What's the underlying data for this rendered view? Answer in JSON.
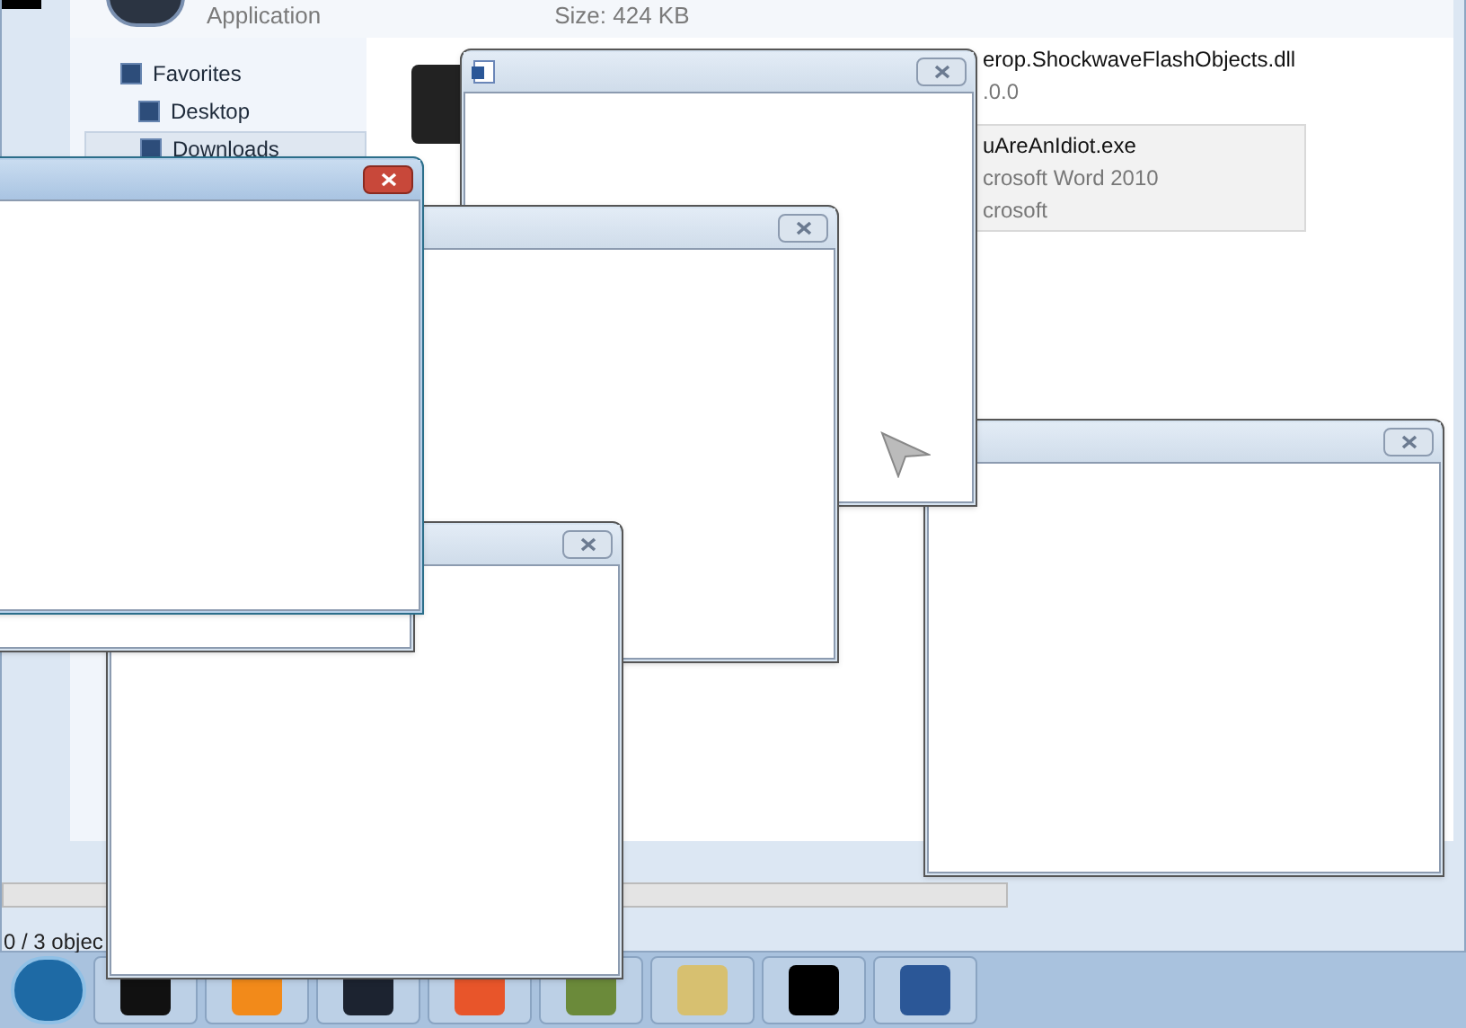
{
  "details_pane": {
    "type_label": "Application",
    "size": "Size: 424 KB"
  },
  "sidebar": {
    "items": [
      {
        "label": "Favorites",
        "selected": false
      },
      {
        "label": "Desktop",
        "selected": false
      },
      {
        "label": "Downloads",
        "selected": true
      }
    ]
  },
  "files": [
    {
      "name": "erop.ShockwaveFlashObjects.dll",
      "lines": [
        ".0.0"
      ],
      "selected": false
    },
    {
      "name": "uAreAnIdiot.exe",
      "lines": [
        "crosoft Word 2010",
        "crosoft"
      ],
      "selected": true
    }
  ],
  "status_bar": "0 / 3 objec",
  "popups": [
    {
      "active": false,
      "kind": "blank"
    },
    {
      "active": false,
      "kind": "document"
    },
    {
      "active": false,
      "kind": "blank"
    },
    {
      "active": false,
      "kind": "blank"
    },
    {
      "active": false,
      "kind": "blank"
    },
    {
      "active": true,
      "kind": "blank"
    }
  ]
}
